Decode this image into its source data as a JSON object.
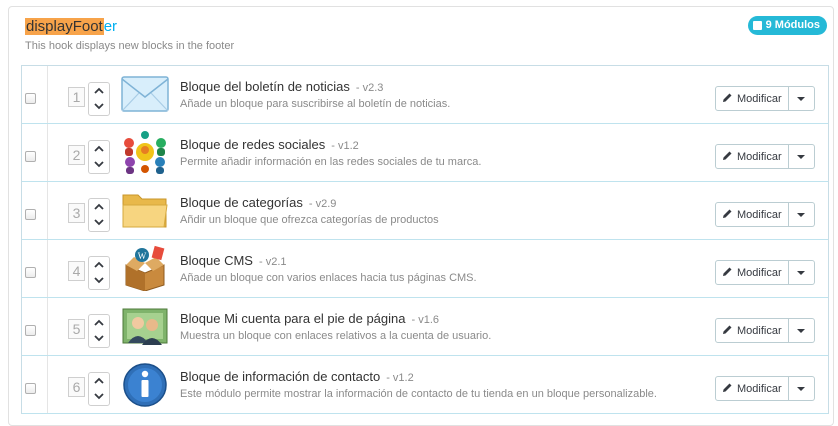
{
  "hook": {
    "title_highlight": "displayFoot",
    "title_rest": "er",
    "description": "This hook displays new blocks in the footer",
    "count_label": "9 Módulos"
  },
  "colors": {
    "accent": "#25b9d7",
    "highlight": "#f7a34a"
  },
  "actions": {
    "modify_label": "Modificar"
  },
  "modules": [
    {
      "position": "1",
      "name": "Bloque del boletín de noticias",
      "version": "- v2.3",
      "description": "Añade un bloque para suscribirse al boletín de noticias.",
      "icon": "envelope-icon"
    },
    {
      "position": "2",
      "name": "Bloque de redes sociales",
      "version": "- v1.2",
      "description": "Permite añadir información en las redes sociales de tu marca.",
      "icon": "social-network-icon"
    },
    {
      "position": "3",
      "name": "Bloque de categorías",
      "version": "- v2.9",
      "description": "Añdir un bloque que ofrezca categorías de productos",
      "icon": "folder-icon"
    },
    {
      "position": "4",
      "name": "Bloque CMS",
      "version": "- v2.1",
      "description": "Añade un bloque con varios enlaces hacia tus páginas CMS.",
      "icon": "cms-box-icon"
    },
    {
      "position": "5",
      "name": "Bloque Mi cuenta para el pie de página",
      "version": "- v1.6",
      "description": "Muestra un bloque con enlaces relativos a la cuenta de usuario.",
      "icon": "account-users-icon"
    },
    {
      "position": "6",
      "name": "Bloque de información de contacto",
      "version": "- v1.2",
      "description": "Este módulo permite mostrar la información de contacto de tu tienda en un bloque personalizable.",
      "icon": "info-icon"
    }
  ]
}
